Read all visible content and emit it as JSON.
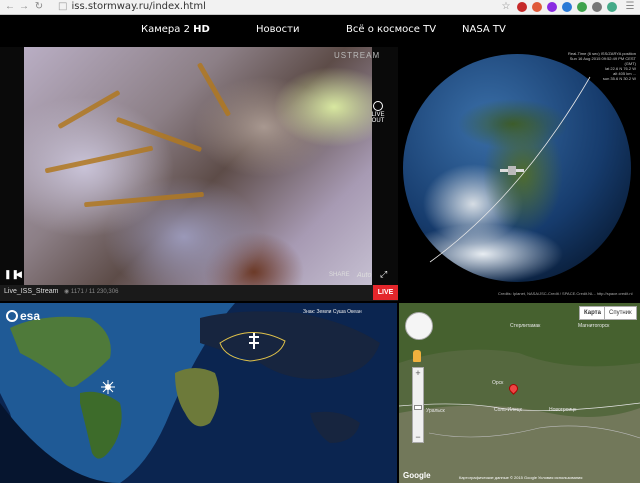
{
  "browser": {
    "url_text": "iss.stormway.ru/index.html",
    "back_icon": "arrow-left-icon",
    "forward_icon": "arrow-right-icon",
    "reload_icon": "reload-icon",
    "star_icon": "star-icon",
    "menu_icon": "hamburger-menu-icon"
  },
  "nav": {
    "camera_label": "Камера 2",
    "camera_hd": "HD",
    "news_label": "Новости",
    "space_tv_label": "Всё о космосе TV",
    "nasa_tv_label": "NASA TV"
  },
  "video": {
    "brand": "USTREAM",
    "live_out_text": "LIVE OUT",
    "share_label": "SHARE",
    "auto_label": "Auto",
    "stream_name": "Live_ISS_Stream",
    "stream_stats": "1171 / 11 230,306",
    "live_badge": "LIVE"
  },
  "globe": {
    "info_lines": [
      "Real-Time (6 sec) ISS/ZARYA position",
      "Sun 16 Aug 2015 09:52:49 PM CEST (GMT)",
      "lat 22.6 N  76.2 W",
      "alt 405 km  ...",
      "sun 35.6 N  30.2 W"
    ],
    "credit": "Credits: Iplanet, NASA/JSC-Credit / SPACE.Credit.NL - http://space.credit.nl"
  },
  "esa_map": {
    "logo_text": "esa",
    "legend_text": "Знак: Земли  Суша  Океан"
  },
  "google_map": {
    "map_tab": "Карта",
    "satellite_tab": "Спутник",
    "labels": [
      {
        "text": "Стерлитамак"
      },
      {
        "text": "Магнитогорск"
      },
      {
        "text": "Орск"
      },
      {
        "text": "Уральск"
      },
      {
        "text": "Соль-Илецк"
      },
      {
        "text": "Новотроицк"
      }
    ],
    "footer": "Картографические данные © 2015 Google  Условия использования",
    "logo": "Google"
  },
  "colors": {
    "live_badge": "#e4262b",
    "top_bg": "#000000",
    "nav_text": "#ffffff"
  }
}
